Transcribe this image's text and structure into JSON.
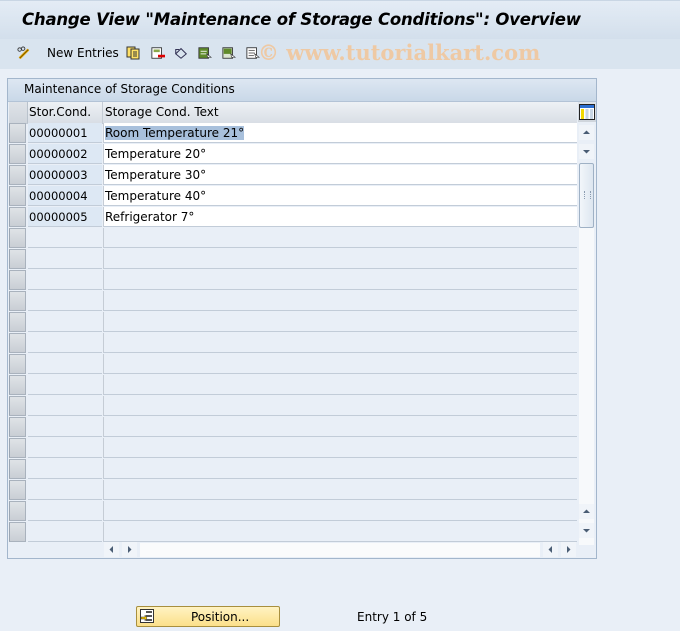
{
  "window": {
    "title": "Change View \"Maintenance of Storage Conditions\": Overview"
  },
  "toolbar": {
    "items": [
      {
        "icon": "pencil-glasses-icon",
        "label": ""
      },
      {
        "icon": "none",
        "label": "New Entries"
      },
      {
        "icon": "copy-icon",
        "label": ""
      },
      {
        "icon": "delete-icon",
        "label": ""
      },
      {
        "icon": "undo-icon",
        "label": ""
      },
      {
        "icon": "select-all-icon",
        "label": ""
      },
      {
        "icon": "select-block-icon",
        "label": ""
      },
      {
        "icon": "deselect-all-icon",
        "label": ""
      }
    ],
    "new_entries_label": "New Entries",
    "watermark": "© www.tutorialkart.com"
  },
  "table": {
    "title": "Maintenance of Storage Conditions",
    "columns": [
      "Stor.Cond.",
      "Storage Cond. Text"
    ],
    "rows": [
      {
        "code": "00000001",
        "text": "Room Temperature 21°",
        "selected_text": true
      },
      {
        "code": "00000002",
        "text": "Temperature 20°"
      },
      {
        "code": "00000003",
        "text": "Temperature 30°"
      },
      {
        "code": "00000004",
        "text": "Temperature 40°"
      },
      {
        "code": "00000005",
        "text": "Refrigerator 7°"
      }
    ],
    "empty_rows": 15
  },
  "footer": {
    "position_button": "Position...",
    "entry_status": "Entry 1 of 5"
  },
  "colors": {
    "accent_button": "#fbe08a",
    "highlight": "#a8c0dc",
    "watermark": "#eec9a4"
  }
}
